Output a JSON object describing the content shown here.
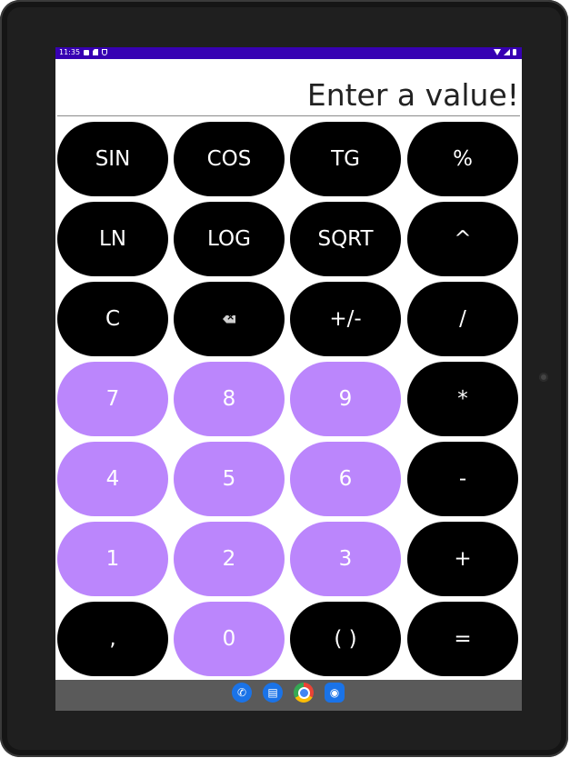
{
  "status_bar": {
    "time": "11:35"
  },
  "display": {
    "text": "Enter a value!"
  },
  "keys": {
    "sin": "SIN",
    "cos": "COS",
    "tg": "TG",
    "percent": "%",
    "ln": "LN",
    "log": "LOG",
    "sqrt": "SQRT",
    "power": "^",
    "clear": "C",
    "plus_minus": "+/-",
    "divide": "/",
    "seven": "7",
    "eight": "8",
    "nine": "9",
    "multiply": "*",
    "four": "4",
    "five": "5",
    "six": "6",
    "minus": "-",
    "one": "1",
    "two": "2",
    "three": "3",
    "plus": "+",
    "comma": ",",
    "zero": "0",
    "parentheses": "( )",
    "equals": "="
  },
  "colors": {
    "status_bar": "#3700b3",
    "digit_key": "#bb86fc",
    "operator_key": "#000000",
    "nav_bar": "#5a5a5a"
  },
  "icons": {
    "backspace": "backspace-icon",
    "dock": [
      "phone-icon",
      "messages-icon",
      "chrome-icon",
      "camera-icon"
    ]
  }
}
